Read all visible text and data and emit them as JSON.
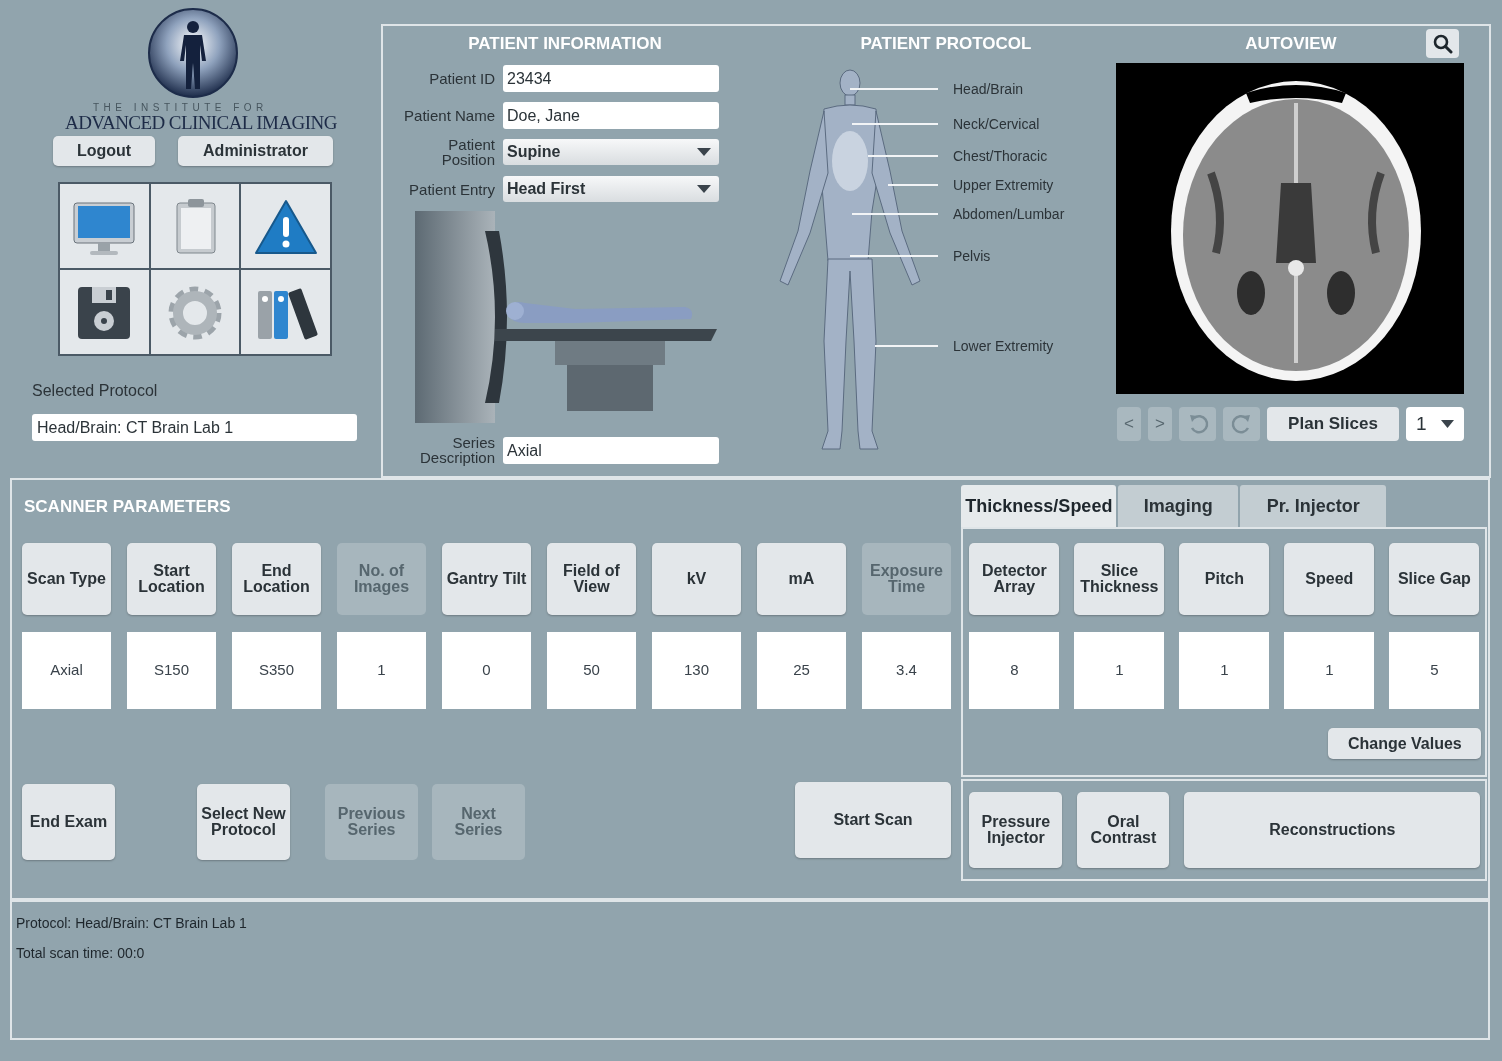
{
  "logo": {
    "tagline": "THE INSTITUTE FOR",
    "name": "ADVANCED CLINICAL IMAGING"
  },
  "account_buttons": [
    {
      "label": "Logout"
    },
    {
      "label": "Administrator"
    }
  ],
  "selected_protocol": {
    "label": "Selected Protocol",
    "value": "Head/Brain: CT Brain Lab 1"
  },
  "patient_information": {
    "title": "PATIENT INFORMATION",
    "fields": [
      {
        "label": "Patient ID",
        "value": "23434",
        "kind": "text"
      },
      {
        "label": "Patient Name",
        "value": "Doe, Jane",
        "kind": "text"
      },
      {
        "label": "Patient Position",
        "value": "Supine",
        "kind": "dropdown"
      },
      {
        "label": "Patient Entry",
        "value": "Head First",
        "kind": "dropdown"
      }
    ],
    "series_description": {
      "label": "Series Description",
      "value": "Axial"
    }
  },
  "patient_protocol": {
    "title": "PATIENT PROTOCOL",
    "regions": [
      "Head/Brain",
      "Neck/Cervical",
      "Chest/Thoracic",
      "Upper Extremity",
      "Abdomen/Lumbar",
      "Pelvis",
      "Lower Extremity"
    ]
  },
  "autoview": {
    "title": "AUTOVIEW",
    "controls": [
      {
        "kind": "text",
        "label": "<",
        "disabled": true
      },
      {
        "kind": "text",
        "label": ">",
        "disabled": true
      },
      {
        "kind": "rotate_left",
        "disabled": true
      },
      {
        "kind": "rotate_right",
        "disabled": true
      },
      {
        "kind": "text",
        "label": "Plan Slices",
        "disabled": false
      }
    ],
    "slice_select": "1"
  },
  "scanner_parameters": {
    "title": "SCANNER PARAMETERS",
    "parameters": [
      {
        "label": "Scan Type",
        "value": "Axial",
        "disabled": false
      },
      {
        "label": "Start Location",
        "value": "S150",
        "disabled": false
      },
      {
        "label": "End Location",
        "value": "S350",
        "disabled": false
      },
      {
        "label": "No. of Images",
        "value": "1",
        "disabled": true
      },
      {
        "label": "Gantry Tilt",
        "value": "0",
        "disabled": false
      },
      {
        "label": "Field of View",
        "value": "50",
        "disabled": false
      },
      {
        "label": "kV",
        "value": "130",
        "disabled": false
      },
      {
        "label": "mA",
        "value": "25",
        "disabled": false
      },
      {
        "label": "Exposure Time",
        "value": "3.4",
        "disabled": true
      }
    ],
    "actions": [
      {
        "label": "End Exam",
        "disabled": false
      },
      {
        "label": "Select New Protocol",
        "disabled": false
      },
      {
        "label": "Previous Series",
        "disabled": true
      },
      {
        "label": "Next Series",
        "disabled": true
      },
      {
        "label": "Start Scan",
        "disabled": false
      }
    ]
  },
  "tabs": [
    {
      "label": "Thickness/Speed",
      "selected": true
    },
    {
      "label": "Imaging",
      "selected": false
    },
    {
      "label": "Pr. Injector",
      "selected": false
    }
  ],
  "tab_parameters": [
    {
      "label": "Detector Array",
      "value": "8"
    },
    {
      "label": "Slice Thickness",
      "value": "1"
    },
    {
      "label": "Pitch",
      "value": "1"
    },
    {
      "label": "Speed",
      "value": "1"
    },
    {
      "label": "Slice Gap",
      "value": "5"
    }
  ],
  "change_values": "Change Values",
  "injector_buttons": [
    "Pressure Injector",
    "Oral Contrast",
    "Reconstructions"
  ],
  "status_lines": [
    "Protocol: Head/Brain: CT Brain Lab 1",
    "Total scan time: 00:0"
  ]
}
